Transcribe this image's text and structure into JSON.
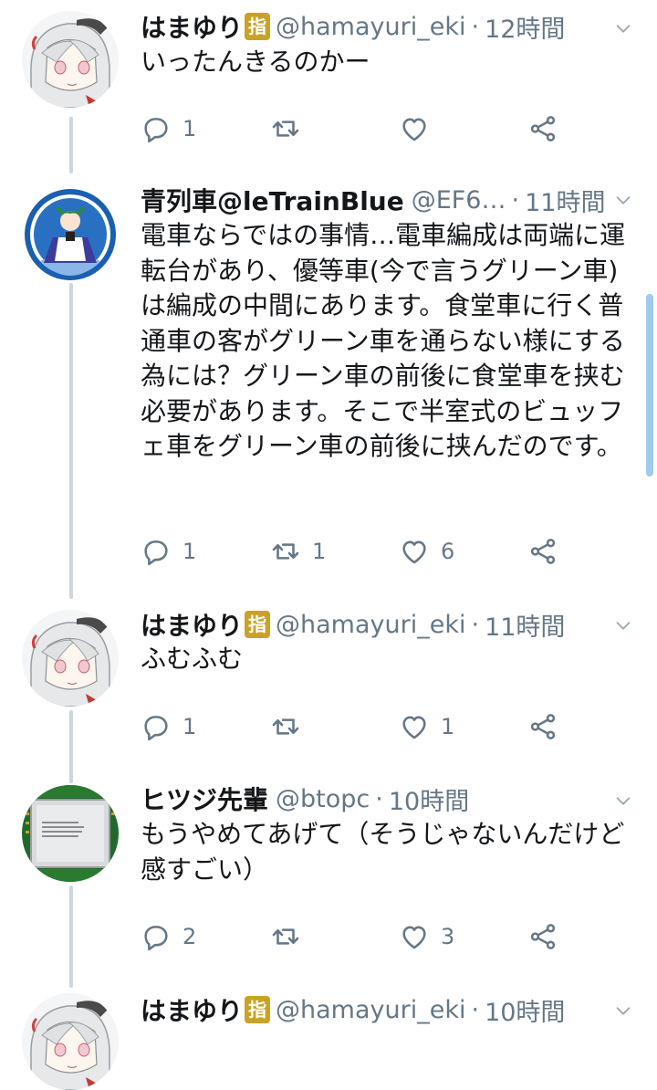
{
  "tweets": [
    {
      "name": "はまゆり",
      "badge": "指",
      "handle": "@hamayuri_eki",
      "time": "12時間",
      "text": "いったんきるのかー",
      "reply_count": "1",
      "retweet_count": "",
      "like_count": "",
      "avatar": "gray-haired-girl-avatar"
    },
    {
      "name": "青列車@leTrainBlue",
      "badge": "",
      "handle": "@EF6…",
      "time": "11時間",
      "text": "電車ならではの事情…電車編成は両端に運転台があり、優等車(今で言うグリーン車)は編成の中間にあります。食堂車に行く普通車の客がグリーン車を通らない様にする為には？グリーン車の前後に食堂車を挟む必要があります。そこで半室式のビュッフェ車をグリーン車の前後に挟んだのです。",
      "reply_count": "1",
      "retweet_count": "1",
      "like_count": "6",
      "avatar": "blue-maid-character-avatar"
    },
    {
      "name": "はまゆり",
      "badge": "指",
      "handle": "@hamayuri_eki",
      "time": "11時間",
      "text": "ふむふむ",
      "reply_count": "1",
      "retweet_count": "",
      "like_count": "1",
      "avatar": "gray-haired-girl-avatar"
    },
    {
      "name": "ヒツジ先輩",
      "badge": "",
      "handle": "@btopc",
      "time": "10時間",
      "text": "もうやめてあげて（そうじゃないんだけど感すごい）",
      "reply_count": "2",
      "retweet_count": "",
      "like_count": "3",
      "avatar": "cpu-chip-avatar"
    },
    {
      "name": "はまゆり",
      "badge": "指",
      "handle": "@hamayuri_eki",
      "time": "10時間",
      "text": "",
      "avatar": "gray-haired-girl-avatar"
    }
  ],
  "separator": "·",
  "icons": {
    "reply": "reply-icon",
    "retweet": "retweet-icon",
    "like": "heart-icon",
    "share": "share-icon",
    "more": "chevron-down-icon"
  },
  "colors": {
    "text": "#14171a",
    "secondary": "#657786",
    "thread_line": "#ccd6dd",
    "badge": "#c9a227",
    "scrollbar": "#8ec2ea"
  }
}
